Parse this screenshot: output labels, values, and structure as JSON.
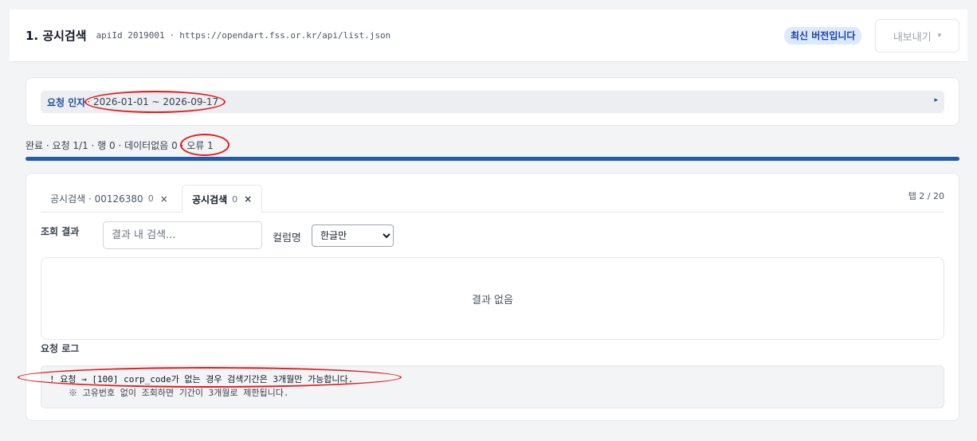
{
  "header": {
    "title": "1. 공시검색",
    "api_id": "apiId 2019001",
    "separator": "·",
    "url": "https://opendart.fss.or.kr/api/list.json",
    "version_badge": "최신 버전입니다",
    "export_label": "내보내기",
    "export_caret": "▾"
  },
  "params": {
    "label": "요청 인자",
    "value": "· 2026-01-01 ~ 2026-09-17",
    "arrow": "▸"
  },
  "status": {
    "text": "완료 · 요청 1/1 · 행 0 · 데이터없음 0 · 오류 1",
    "progress": 1.0,
    "progress_color": "#1f5ca9"
  },
  "tabs": {
    "items": [
      {
        "label": "공시검색 · 00126380",
        "count": "0",
        "close": "×",
        "active": false
      },
      {
        "label": "공시검색",
        "count": "0",
        "close": "×",
        "active": true
      }
    ],
    "counter": "탭 2 / 20"
  },
  "results": {
    "label": "조회 결과",
    "search_placeholder": "결과 내 검색...",
    "column_label": "컬럼명",
    "column_select_value": "한글만",
    "empty_text": "결과 없음"
  },
  "log": {
    "label": "요청 로그",
    "line": "! 요청 → [100] corp_code가 없는 경우 검색기간은 3개월만 가능합니다.",
    "sub": "※ 고유번호 없이 조회하면 기간이 3개월로 제한됩니다."
  },
  "colors": {
    "accent": "#1f5ca9",
    "annotation": "#e11d1d"
  }
}
